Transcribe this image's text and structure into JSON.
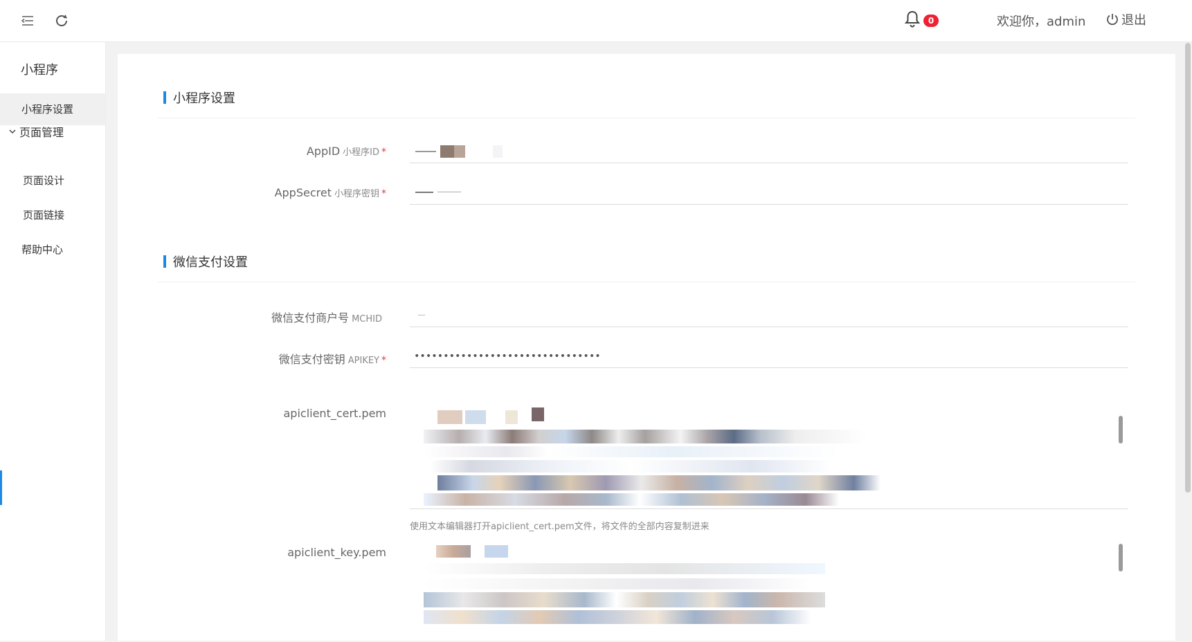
{
  "topbar": {
    "welcome": "欢迎你，admin",
    "logout": "退出",
    "notification_count": "0"
  },
  "sidebar": {
    "title": "小程序",
    "items": [
      {
        "label": "小程序设置",
        "active": true
      },
      {
        "label": "页面管理",
        "group": true
      },
      {
        "label": "页面设计"
      },
      {
        "label": "页面链接"
      },
      {
        "label": "帮助中心"
      }
    ]
  },
  "sections": {
    "miniprogram": {
      "title": "小程序设置",
      "appid": {
        "label": "AppID",
        "sub": "小程序ID",
        "required": "*"
      },
      "appsecret": {
        "label": "AppSecret",
        "sub": "小程序密钥",
        "required": "*"
      }
    },
    "wxpay": {
      "title": "微信支付设置",
      "mchid": {
        "label": "微信支付商户号",
        "sub": "MCHID"
      },
      "apikey": {
        "label": "微信支付密钥",
        "sub": "APIKEY",
        "required": "*",
        "value": "••••••••••••••••••••••••••••••••"
      },
      "cert": {
        "label": "apiclient_cert.pem",
        "hint": "使用文本编辑器打开apiclient_cert.pem文件，将文件的全部内容复制进来"
      },
      "key": {
        "label": "apiclient_key.pem"
      }
    }
  },
  "colors": {
    "accent": "#1e88e5",
    "badge": "#ee2233",
    "required": "#e53935"
  }
}
